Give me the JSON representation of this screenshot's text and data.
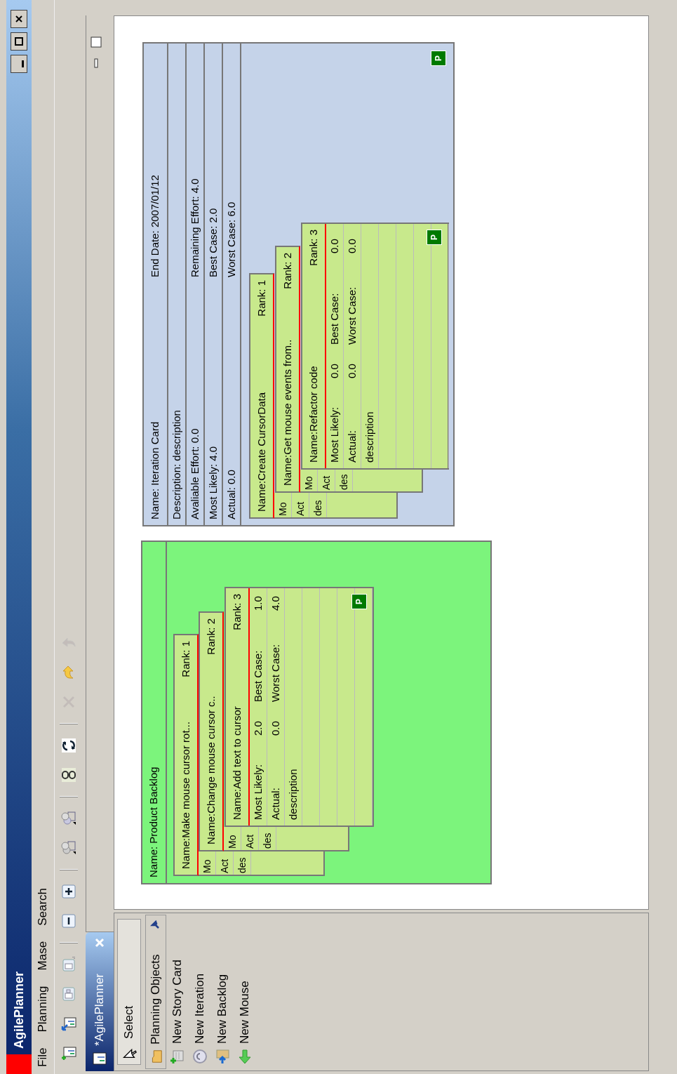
{
  "window": {
    "title": "AgilePlanner"
  },
  "menu": [
    "File",
    "Planning",
    "Mase",
    "Search"
  ],
  "toolbar": [
    {
      "kind": "button",
      "disabled": false
    },
    {
      "kind": "button",
      "disabled": false
    },
    {
      "kind": "button",
      "disabled": false
    },
    {
      "kind": "button",
      "disabled": false
    },
    {
      "kind": "separator"
    },
    {
      "kind": "button",
      "disabled": false
    },
    {
      "kind": "button",
      "disabled": false
    },
    {
      "kind": "separator"
    },
    {
      "kind": "button",
      "disabled": false
    },
    {
      "kind": "button",
      "disabled": false
    },
    {
      "kind": "separator"
    },
    {
      "kind": "button",
      "disabled": false
    },
    {
      "kind": "button",
      "disabled": false
    },
    {
      "kind": "separator"
    },
    {
      "kind": "button",
      "disabled": true
    },
    {
      "kind": "button",
      "disabled": false
    },
    {
      "kind": "button",
      "disabled": true
    }
  ],
  "editor_tab": {
    "title": "*AgilePlanner"
  },
  "palette": {
    "tool": "Select",
    "drawer": {
      "title": "Planning Objects",
      "items": [
        "New Story Card",
        "New Iteration",
        "New Backlog",
        "New Mouse"
      ]
    }
  },
  "canvas": {
    "backlog": {
      "name": "Name: Product Backlog",
      "cards": [
        {
          "name": "Name:Make mouse cursor rot...",
          "rank": "Rank: 1",
          "fields": [
            {
              "label": "Mo"
            },
            {
              "label": "Act"
            },
            {
              "label": "des"
            }
          ]
        },
        {
          "name": "Name:Change mouse cursor c..",
          "rank": "Rank: 2",
          "fields": [
            {
              "label": "Mo"
            },
            {
              "label": "Act"
            },
            {
              "label": "des"
            }
          ]
        },
        {
          "name": "Name:Add text to cursor",
          "rank": "Rank: 3",
          "badge": "P",
          "fields": [
            {
              "label": "Most Likely:",
              "value": "2.0",
              "label2": "Best Case:",
              "value2": "1.0"
            },
            {
              "label": "Actual:",
              "value": "0.0",
              "label2": "Worst Case:",
              "value2": "4.0"
            },
            {
              "label": "description"
            }
          ]
        }
      ]
    },
    "iteration": {
      "name": "Name: Iteration Card",
      "end_date": "End Date: 2007/01/12",
      "description": "Description: description",
      "lines": [
        {
          "left": "Avaliable Effort: 0.0",
          "right": "Remaining Effort: 4.0"
        },
        {
          "left": "Most Likely: 4.0",
          "right": "Best Case: 2.0"
        },
        {
          "left": "Actual: 0.0",
          "right": "Worst Case: 6.0"
        }
      ],
      "badge": "P",
      "cards": [
        {
          "name": "Name:Create CursorData",
          "rank": "Rank: 1",
          "fields": [
            {
              "label": "Mo"
            },
            {
              "label": "Act"
            },
            {
              "label": "des"
            }
          ]
        },
        {
          "name": "Name:Get mouse events from..",
          "rank": "Rank: 2",
          "fields": [
            {
              "label": "Mo"
            },
            {
              "label": "Act"
            },
            {
              "label": "des"
            }
          ]
        },
        {
          "name": "Name:Refactor code",
          "rank": "Rank: 3",
          "badge": "P",
          "fields": [
            {
              "label": "Most Likely:",
              "value": "0.0",
              "label2": "Best Case:",
              "value2": "0.0"
            },
            {
              "label": "Actual:",
              "value": "0.0",
              "label2": "Worst Case:",
              "value2": "0.0"
            },
            {
              "label": "description"
            }
          ]
        }
      ]
    }
  }
}
